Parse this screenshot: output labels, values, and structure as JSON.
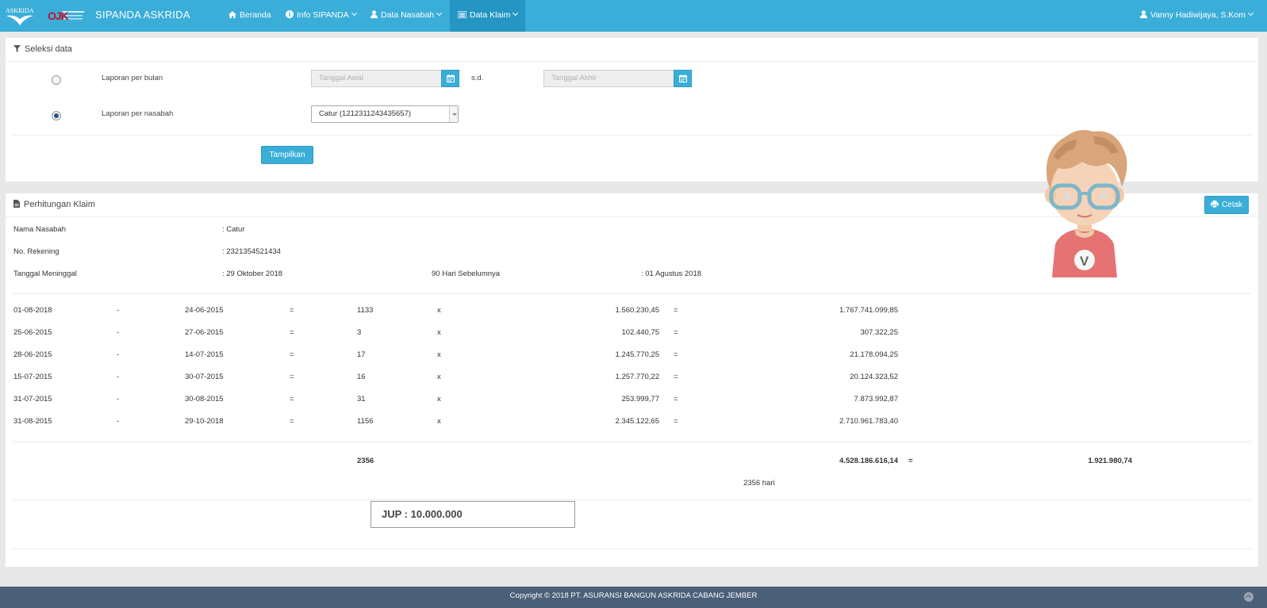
{
  "navbar": {
    "title": "SIPANDA ASKRIDA",
    "brand_logo_text": "ASKRIDA",
    "ojk_logo_text": "OJK",
    "items": [
      {
        "label": "Beranda",
        "icon": "home-icon"
      },
      {
        "label": "Info SIPANDA",
        "icon": "info-icon"
      },
      {
        "label": "Data Nasabah",
        "icon": "user-icon"
      },
      {
        "label": "Data Klaim",
        "icon": "list-icon"
      }
    ],
    "user": "Vanny Hadiwijaya, S.Kom"
  },
  "seleksi": {
    "title": "Seleksi data",
    "opt_bulan": "Laporan per bulan",
    "opt_nasabah": "Laporan per nasabah",
    "tanggal_awal_placeholder": "Tanggal Awal",
    "sd": "s.d.",
    "tanggal_akhir_placeholder": "Tanggal Akhir",
    "nasabah_selected": "Catur (1212311243435657)",
    "tampilkan": "Tampilkan"
  },
  "perhitungan": {
    "title": "Perhitungan Klaim",
    "cetak": "Cetak",
    "info": {
      "nama_label": "Nama Nasabah",
      "nama_value": ": Catur",
      "rek_label": "No. Rekening",
      "rek_value": ": 2321354521434",
      "tgl_label": "Tanggal Meninggal",
      "tgl_value": ": 29 Oktober 2018",
      "hari_label": "90 Hari Sebelumnya",
      "hari_value": ": 01 Agustus 2018"
    },
    "rows": [
      {
        "from": "01-08-2018",
        "dash": "-",
        "to": "24-06-2015",
        "eq1": "=",
        "days": "1133",
        "x": "x",
        "rate": "1.560.230,45",
        "eq2": "=",
        "result": "1.767.741.099,85"
      },
      {
        "from": "25-06-2015",
        "dash": "-",
        "to": "27-06-2015",
        "eq1": "=",
        "days": "3",
        "x": "x",
        "rate": "102.440,75",
        "eq2": "=",
        "result": "307.322,25"
      },
      {
        "from": "28-06-2015",
        "dash": "-",
        "to": "14-07-2015",
        "eq1": "=",
        "days": "17",
        "x": "x",
        "rate": "1.245.770,25",
        "eq2": "=",
        "result": "21.178.094,25"
      },
      {
        "from": "15-07-2015",
        "dash": "-",
        "to": "30-07-2015",
        "eq1": "=",
        "days": "16",
        "x": "x",
        "rate": "1.257.770,22",
        "eq2": "=",
        "result": "20.124.323,52"
      },
      {
        "from": "31-07-2015",
        "dash": "-",
        "to": "30-08-2015",
        "eq1": "=",
        "days": "31",
        "x": "x",
        "rate": "253.999,77",
        "eq2": "=",
        "result": "7.873.992,87"
      },
      {
        "from": "31-08-2015",
        "dash": "-",
        "to": "29-10-2018",
        "eq1": "=",
        "days": "1156",
        "x": "x",
        "rate": "2.345.122,65",
        "eq2": "=",
        "result": "2.710.961.783,40"
      }
    ],
    "total": {
      "days": "2356",
      "sum": "4.528.186.616,14",
      "eq": "=",
      "avg": "1.921.980,74",
      "hari": "2356 hari"
    },
    "jup": "JUP : 10.000.000"
  },
  "footer": "Copyright © 2018 PT. ASURANSI BANGUN ASKRIDA CABANG JEMBER",
  "avatar_letter": "V",
  "colors": {
    "navbar": "#3aaed8",
    "navbar_active": "#2596c4",
    "footer": "#4b5f78"
  }
}
